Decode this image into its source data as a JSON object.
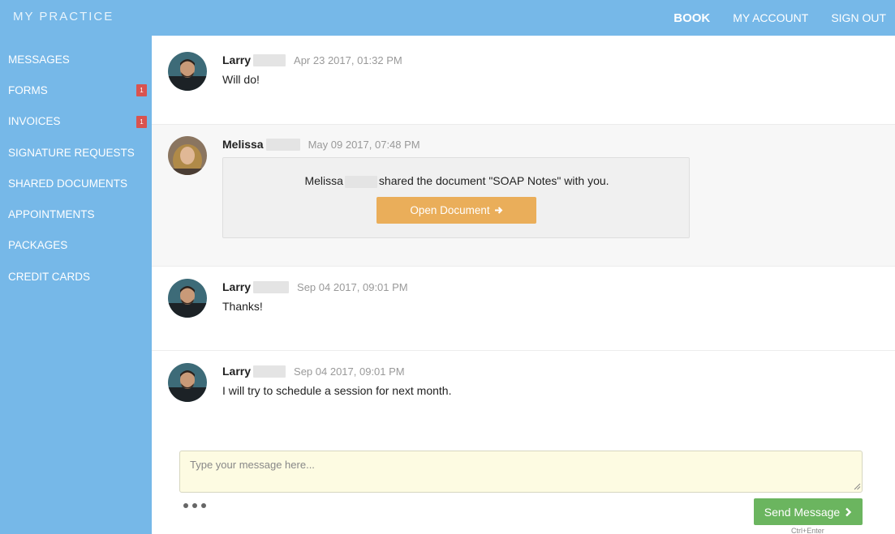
{
  "app": {
    "brand": "MY PRACTICE",
    "nav": [
      {
        "label": "BOOK"
      },
      {
        "label": "MY ACCOUNT"
      },
      {
        "label": "SIGN OUT"
      }
    ]
  },
  "sidebar": {
    "items": [
      {
        "label": "MESSAGES",
        "badge": ""
      },
      {
        "label": "FORMS",
        "badge": "1"
      },
      {
        "label": "INVOICES",
        "badge": "1"
      },
      {
        "label": "SIGNATURE REQUESTS",
        "badge": ""
      },
      {
        "label": "SHARED DOCUMENTS",
        "badge": ""
      },
      {
        "label": "APPOINTMENTS",
        "badge": ""
      },
      {
        "label": "PACKAGES",
        "badge": ""
      },
      {
        "label": "CREDIT CARDS",
        "badge": ""
      }
    ]
  },
  "messages": [
    {
      "sender": "Larry",
      "time": "Apr 23 2017, 01:32 PM",
      "text": "Will do!"
    },
    {
      "sender": "Melissa",
      "time": "May 09 2017, 07:48 PM",
      "share": {
        "name": "Melissa",
        "text": "shared the document \"SOAP Notes\" with you.",
        "button": "Open Document"
      }
    },
    {
      "sender": "Larry",
      "time": "Sep 04 2017, 09:01 PM",
      "text": "Thanks!"
    },
    {
      "sender": "Larry",
      "time": "Sep 04 2017, 09:01 PM",
      "text": "I will try to schedule a session for next month."
    }
  ],
  "compose": {
    "placeholder": "Type your message here...",
    "send_label": "Send Message",
    "hint": "Ctrl+Enter"
  },
  "colors": {
    "header_bg": "#76b8e8",
    "badge": "#d9534f",
    "open_button": "#eaae5a",
    "send_button": "#6bb55f",
    "compose_bg": "#fdfbe2"
  }
}
